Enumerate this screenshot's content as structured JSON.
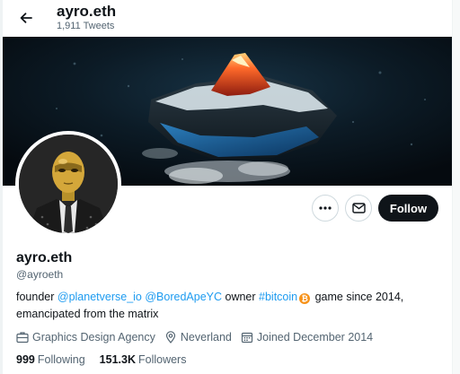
{
  "header": {
    "title": "ayro.eth",
    "tweet_count": "1,911 Tweets"
  },
  "profile": {
    "display_name": "ayro.eth",
    "handle": "@ayroeth",
    "follow_label": "Follow"
  },
  "bio": {
    "text_1": "founder ",
    "link_1": "@planetverse_io",
    "link_2": "@BoredApeYC",
    "text_2": " owner ",
    "link_3": "#bitcoin",
    "bitcoin_symbol": "₿",
    "text_3": " game since 2014,",
    "line_2": "emancipated from the matrix"
  },
  "meta": {
    "category": "Graphics Design Agency",
    "location": "Neverland",
    "joined": "Joined December 2014"
  },
  "stats": {
    "following_count": "999",
    "following_label": "Following",
    "followers_count": "151.3K",
    "followers_label": "Followers"
  },
  "icons": {
    "back": "arrow-left-icon",
    "more": "more-horizontal-icon",
    "message": "envelope-icon",
    "category": "briefcase-icon",
    "location": "location-pin-icon",
    "joined": "calendar-icon"
  },
  "colors": {
    "link": "#1d9bf0",
    "follow_button": "#0f1419",
    "secondary_text": "#536471",
    "bitcoin": "#f7931a"
  }
}
